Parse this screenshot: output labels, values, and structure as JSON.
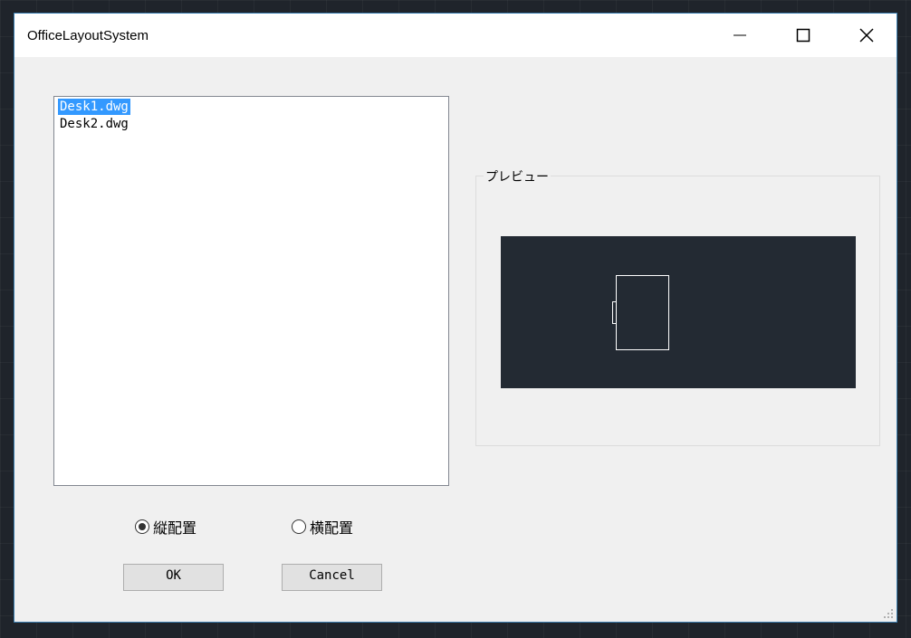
{
  "window": {
    "title": "OfficeLayoutSystem",
    "controls": {
      "minimize_icon": "minimize-icon",
      "maximize_icon": "maximize-icon",
      "close_icon": "close-icon"
    }
  },
  "file_list": {
    "items": [
      {
        "label": "Desk1.dwg",
        "selected": true
      },
      {
        "label": "Desk2.dwg",
        "selected": false
      }
    ]
  },
  "preview": {
    "label": "プレビュー",
    "background_color": "#232a33",
    "stroke_color": "#ffffff"
  },
  "orientation": {
    "options": [
      {
        "label": "縦配置",
        "checked": true
      },
      {
        "label": "横配置",
        "checked": false
      }
    ]
  },
  "buttons": {
    "ok_label": "OK",
    "cancel_label": "Cancel"
  },
  "colors": {
    "selection": "#3399ff",
    "window_border": "#3c7fb1"
  }
}
